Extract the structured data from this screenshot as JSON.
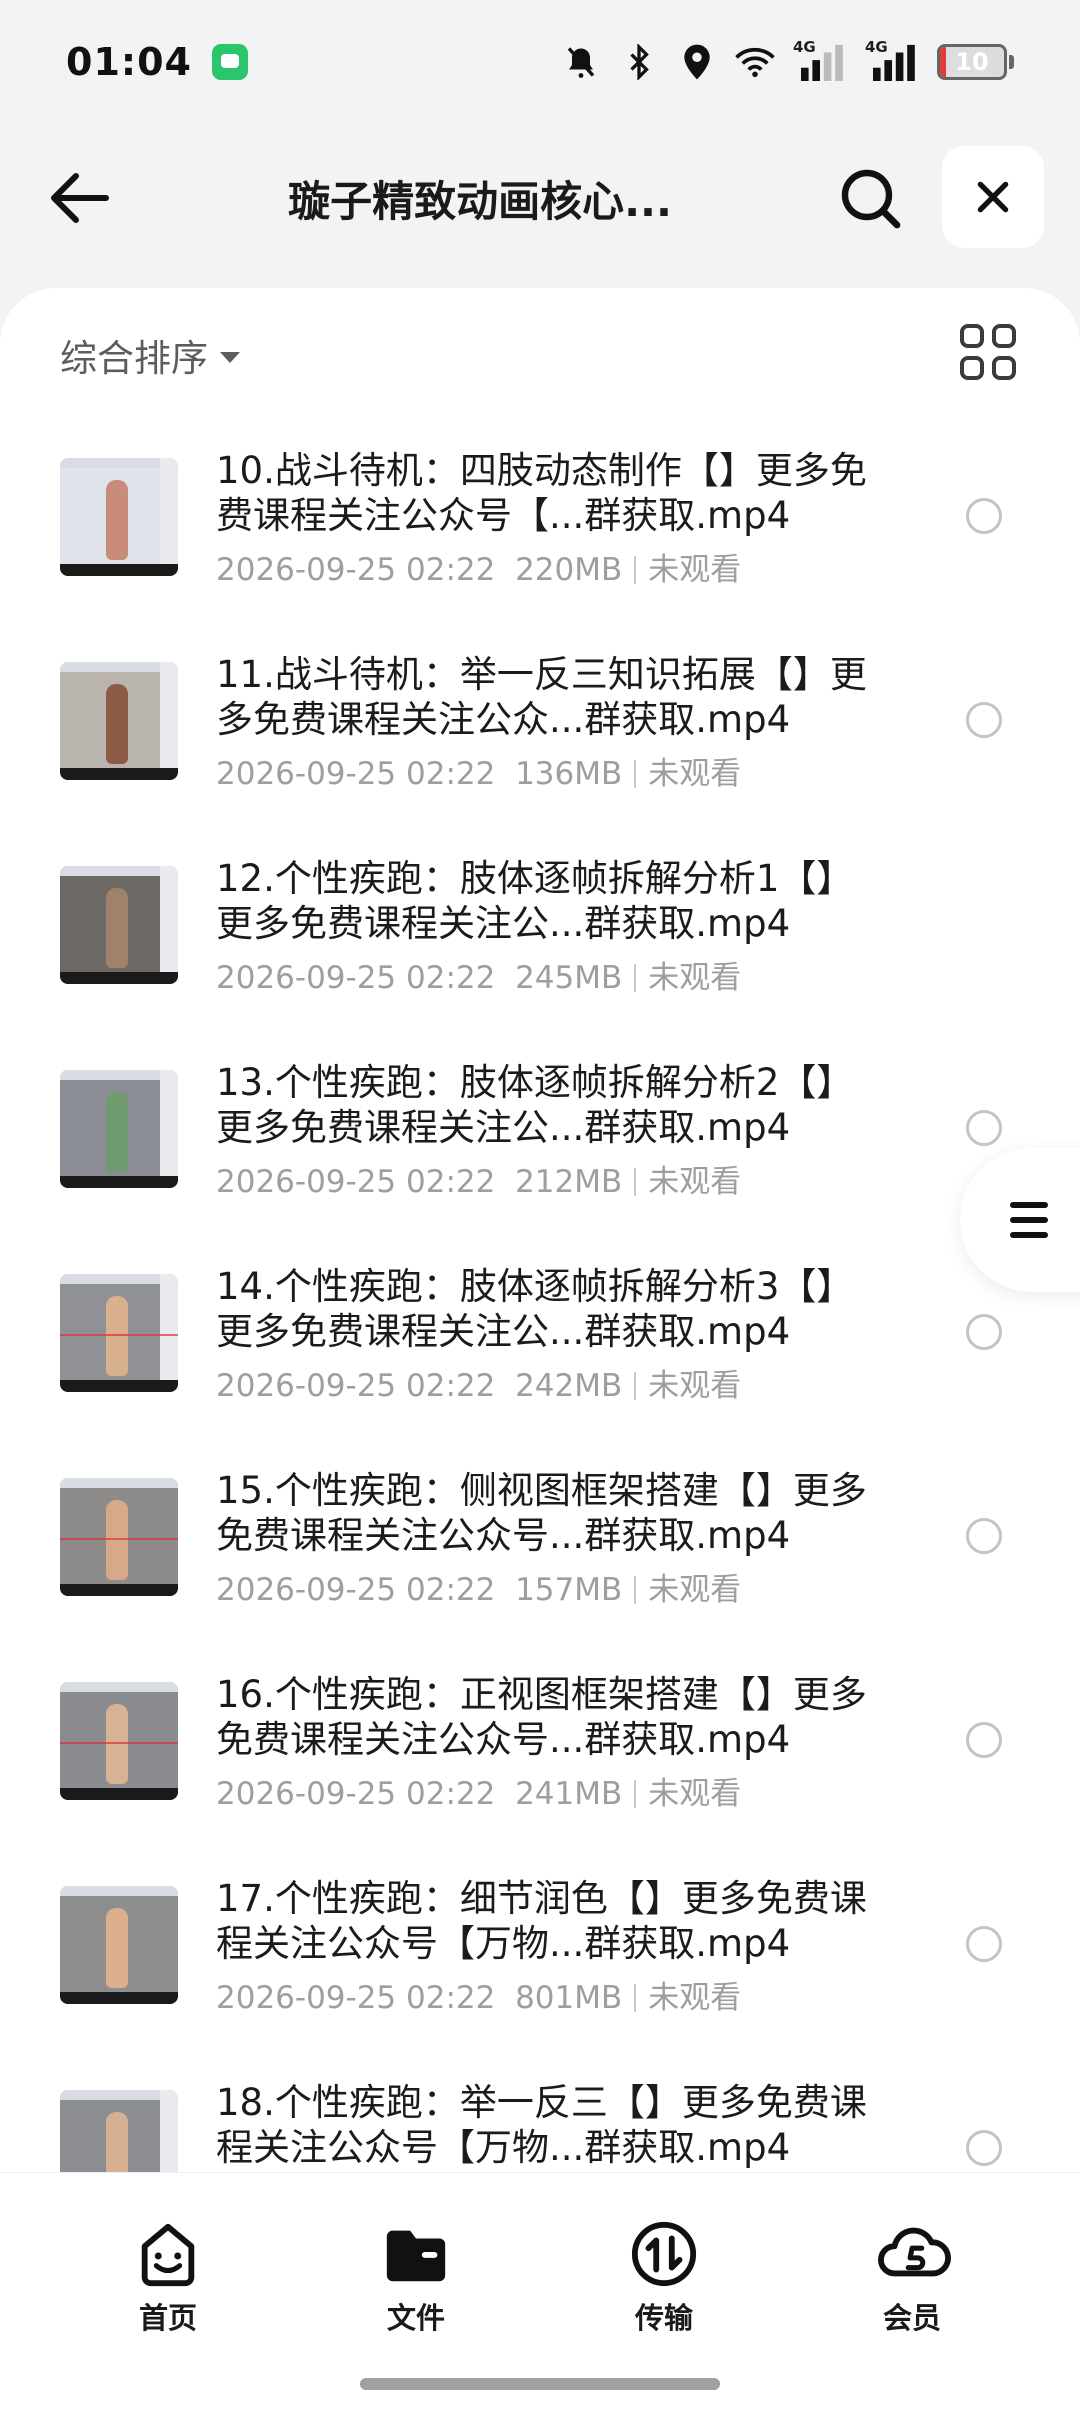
{
  "status_bar": {
    "time": "01:04",
    "battery_level": "10",
    "network_label_1": "4G",
    "network_label_2": "4G",
    "icons": [
      "mute-bell-icon",
      "bluetooth-icon",
      "location-icon",
      "wifi-icon",
      "signal-icon",
      "signal-icon",
      "battery-icon"
    ]
  },
  "header": {
    "title": "璇子精致动画核心..."
  },
  "toolbar": {
    "sort_label": "综合排序"
  },
  "files": [
    {
      "name": "10.战斗待机：四肢动态制作【】更多免费课程关注公众号【...群获取.mp4",
      "date": "2026-09-25 02:22",
      "size": "220MB",
      "status": "未观看",
      "thumb_bg": "#dfe3ea",
      "thumb_fig": "#c98b7a"
    },
    {
      "name": "11.战斗待机：举一反三知识拓展【】更多免费课程关注公众...群获取.mp4",
      "date": "2026-09-25 02:22",
      "size": "136MB",
      "status": "未观看",
      "thumb_bg": "#b9b4ad",
      "thumb_fig": "#8c5a45"
    },
    {
      "name": "12.个性疾跑：肢体逐帧拆解分析1【】更多免费课程关注公...群获取.mp4",
      "date": "2026-09-25 02:22",
      "size": "245MB",
      "status": "未观看",
      "thumb_bg": "#6d6a66",
      "thumb_fig": "#a0826a"
    },
    {
      "name": "13.个性疾跑：肢体逐帧拆解分析2【】更多免费课程关注公...群获取.mp4",
      "date": "2026-09-25 02:22",
      "size": "212MB",
      "status": "未观看",
      "thumb_bg": "#8a8d93",
      "thumb_fig": "#6f9b6f"
    },
    {
      "name": "14.个性疾跑：肢体逐帧拆解分析3【】更多免费课程关注公...群获取.mp4",
      "date": "2026-09-25 02:22",
      "size": "242MB",
      "status": "未观看",
      "thumb_bg": "#8f9196",
      "thumb_fig": "#d9b08e"
    },
    {
      "name": "15.个性疾跑：侧视图框架搭建【】更多免费课程关注公众号...群获取.mp4",
      "date": "2026-09-25 02:22",
      "size": "157MB",
      "status": "未观看",
      "thumb_bg": "#8e8c8a",
      "thumb_fig": "#d8a88a"
    },
    {
      "name": "16.个性疾跑：正视图框架搭建【】更多免费课程关注公众号...群获取.mp4",
      "date": "2026-09-25 02:22",
      "size": "241MB",
      "status": "未观看",
      "thumb_bg": "#8b8c8f",
      "thumb_fig": "#d7b394"
    },
    {
      "name": "17.个性疾跑：细节润色【】更多免费课程关注公众号【万物...群获取.mp4",
      "date": "2026-09-25 02:22",
      "size": "801MB",
      "status": "未观看",
      "thumb_bg": "#8d8e90",
      "thumb_fig": "#dcb08f"
    },
    {
      "name": "18.个性疾跑：举一反三【】更多免费课程关注公众号【万物...群获取.mp4",
      "date": "",
      "size": "",
      "status": "",
      "thumb_bg": "#8c8d90",
      "thumb_fig": "#d6b090"
    }
  ],
  "bottom_nav": {
    "items": [
      {
        "label": "首页",
        "icon": "home-icon"
      },
      {
        "label": "文件",
        "icon": "folder-icon"
      },
      {
        "label": "传输",
        "icon": "transfer-icon"
      },
      {
        "label": "会员",
        "icon": "vip-icon"
      }
    ]
  },
  "colors": {
    "background": "#f2f3f5",
    "battery_low": "#e23b3b",
    "meta_text": "#9e9e9e"
  }
}
